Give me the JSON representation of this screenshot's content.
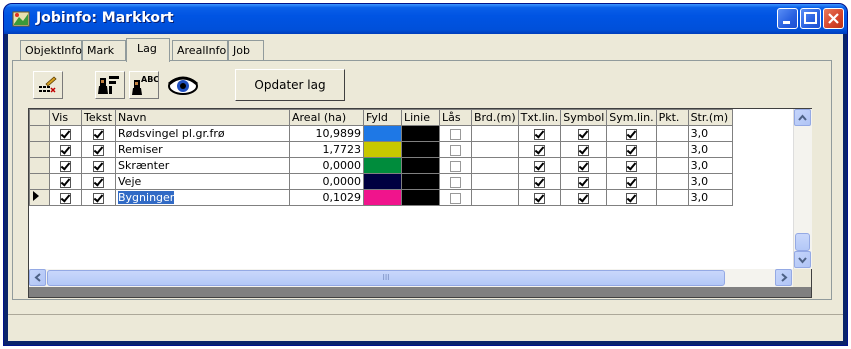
{
  "window": {
    "title": "Jobinfo: Markkort"
  },
  "tabs": [
    {
      "label": "ObjektInfo",
      "active": false
    },
    {
      "label": "Mark",
      "active": false
    },
    {
      "label": "Lag",
      "active": true
    },
    {
      "label": "ArealInfo",
      "active": false
    },
    {
      "label": "Job",
      "active": false
    }
  ],
  "toolbar": {
    "update_label": "Opdater lag",
    "icons": [
      "layer-list-icon",
      "layer-properties-icon",
      "text-layer-icon",
      "eye-icon"
    ]
  },
  "grid": {
    "columns": [
      "Vis",
      "Tekst",
      "Navn",
      "Areal (ha)",
      "Fyld",
      "Linie",
      "Lås",
      "Brd.(m)",
      "Txt.lin.",
      "Symbol",
      "Sym.lin.",
      "Pkt.",
      "Str.(m)"
    ],
    "rows": [
      {
        "vis": true,
        "tekst": true,
        "navn": "Rødsvingel pl.gr.frø",
        "areal": "10,9899",
        "fyld": "#1e78e6",
        "linie": "#000000",
        "laas": false,
        "txtlin": true,
        "symbol": true,
        "symlin": true,
        "str": "3,0"
      },
      {
        "vis": true,
        "tekst": true,
        "navn": "Remiser",
        "areal": "1,7723",
        "fyld": "#c8c800",
        "linie": "#000000",
        "laas": false,
        "txtlin": true,
        "symbol": true,
        "symlin": true,
        "str": "3,0"
      },
      {
        "vis": true,
        "tekst": true,
        "navn": "Skrænter",
        "areal": "0,0000",
        "fyld": "#008c3c",
        "linie": "#000000",
        "laas": false,
        "txtlin": true,
        "symbol": true,
        "symlin": true,
        "str": "3,0"
      },
      {
        "vis": true,
        "tekst": true,
        "navn": "Veje",
        "areal": "0,0000",
        "fyld": "#000040",
        "linie": "#000000",
        "laas": false,
        "txtlin": true,
        "symbol": true,
        "symlin": true,
        "str": "3,0"
      },
      {
        "vis": true,
        "tekst": true,
        "navn": "Bygninger",
        "areal": "0,1029",
        "fyld": "#f0148c",
        "linie": "#000000",
        "laas": false,
        "txtlin": true,
        "symbol": true,
        "symlin": true,
        "str": "3,0",
        "current": true
      }
    ],
    "scrollbar_glyph": "III"
  },
  "colors": {
    "titlebar": "#0054e3",
    "face": "#ece9d8",
    "selection": "#316ac5"
  }
}
